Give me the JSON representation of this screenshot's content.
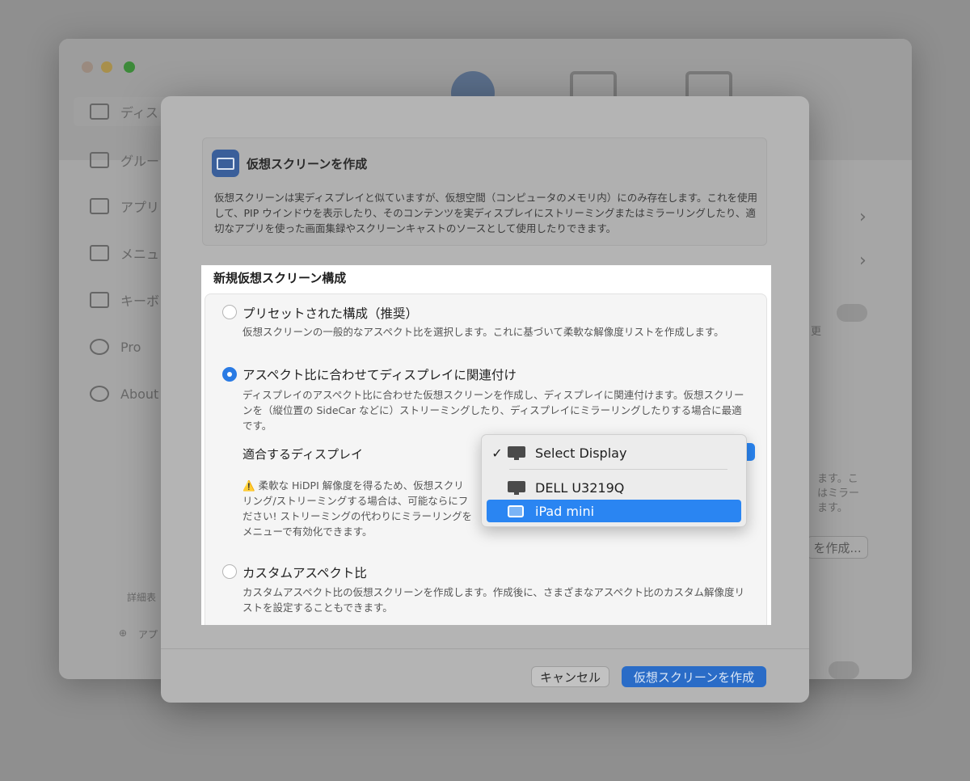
{
  "background_window": {
    "sidebar": [
      {
        "label": "ディス",
        "icon": "display-icon"
      },
      {
        "label": "グルー",
        "icon": "group-icon"
      },
      {
        "label": "アプリ",
        "icon": "app-icon"
      },
      {
        "label": "メニュ",
        "icon": "menu-icon"
      },
      {
        "label": "キーボ",
        "icon": "keyboard-icon"
      },
      {
        "label": "Pro",
        "icon": "pro-icon"
      },
      {
        "label": "About",
        "icon": "about-icon"
      }
    ],
    "detail_label": "詳細表",
    "add_label": "アプ",
    "right_fragments": [
      "更",
      "ます。こ",
      "はミラー",
      "ます。"
    ],
    "create_button": "を作成..."
  },
  "dialog": {
    "title": "仮想スクリーンを作成",
    "description": "仮想スクリーンは実ディスプレイと似ていますが、仮想空間（コンピュータのメモリ内）にのみ存在します。これを使用して、PIP ウインドウを表示したり、そのコンテンツを実ディスプレイにストリーミングまたはミラーリングしたり、適切なアプリを使った画面集録やスクリーンキャストのソースとして使用したりできます。",
    "section_heading": "新規仮想スクリーン構成",
    "options": [
      {
        "title": "プリセットされた構成（推奨）",
        "description": "仮想スクリーンの一般的なアスペクト比を選択します。これに基づいて柔軟な解像度リストを作成します。",
        "selected": false
      },
      {
        "title": "アスペクト比に合わせてディスプレイに関連付け",
        "description": "ディスプレイのアスペクト比に合わせた仮想スクリーンを作成し、ディスプレイに関連付けます。仮想スクリーンを（縦位置の SideCar などに）ストリーミングしたり、ディスプレイにミラーリングしたりする場合に最適です。",
        "selected": true
      },
      {
        "title": "カスタムアスペクト比",
        "description": "カスタムアスペクト比の仮想スクリーンを作成します。作成後に、さまざまなアスペクト比のカスタム解像度リストを設定することもできます。",
        "selected": false
      }
    ],
    "matching_display_label": "適合するディスプレイ",
    "warning_lines": [
      "柔軟な HiDPI 解像度を得るため、仮想スクリ",
      "リング/ストリーミングする場合は、可能ならにフ",
      "ださい! ストリーミングの代わりにミラーリングを",
      "メニューで有効化できます。"
    ],
    "cancel_label": "キャンセル",
    "create_label": "仮想スクリーンを作成"
  },
  "display_menu": {
    "items": [
      {
        "label": "Select Display",
        "checked": true,
        "icon": "display-warning-icon"
      },
      {
        "label": "DELL U3219Q",
        "checked": false,
        "icon": "monitor-icon"
      },
      {
        "label": "iPad mini",
        "checked": false,
        "icon": "ipad-icon",
        "highlighted": true
      }
    ],
    "check_mark": "✓",
    "warning_mark": "⚠️"
  },
  "colors": {
    "accent": "#2a85f2",
    "primary_button": "#2a6cc7",
    "dim_overlay": "#8f8f8f"
  }
}
